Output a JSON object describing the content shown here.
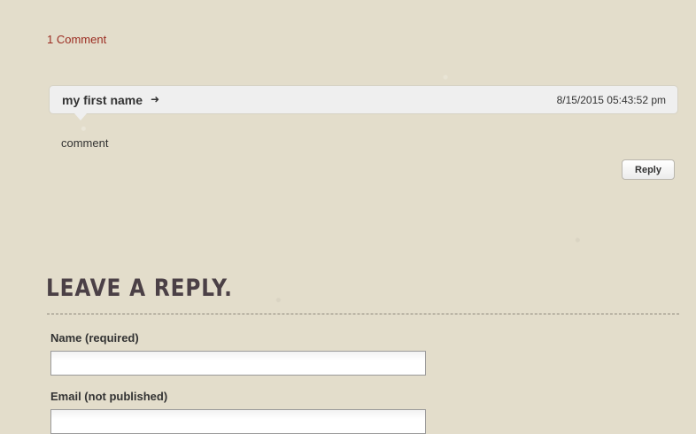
{
  "comments": {
    "count_label": "1 Comment",
    "items": [
      {
        "author": "my first name",
        "author_link_icon": "arrow-right-icon",
        "date": "8/15/2015 05:43:52 pm",
        "text": "comment",
        "reply_label": "Reply"
      }
    ]
  },
  "reply_form": {
    "title": "LEAVE A REPLY.",
    "name_label": "Name (required)",
    "name_value": "",
    "email_label": "Email (not published)",
    "email_value": ""
  },
  "colors": {
    "background": "#e3ddcb",
    "link": "#9b2c21",
    "title": "#4b4046",
    "comment_box": "#efefef"
  }
}
